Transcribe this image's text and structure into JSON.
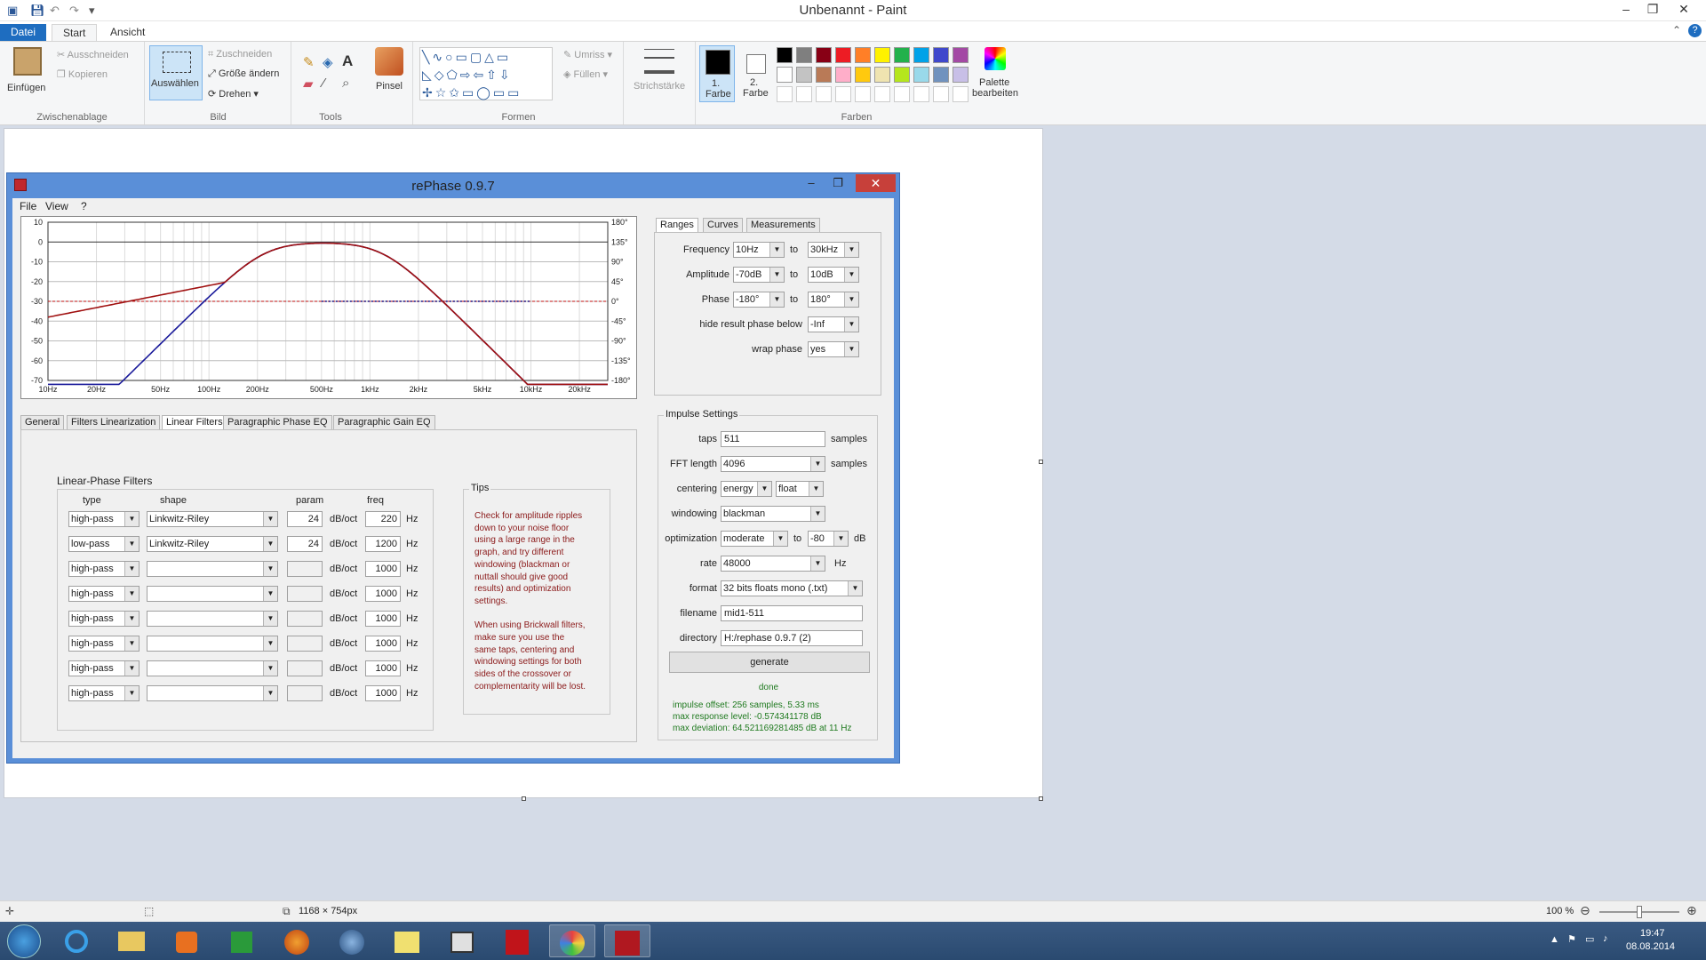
{
  "paint": {
    "title": "Unbenannt - Paint",
    "tabs": {
      "file": "Datei",
      "start": "Start",
      "view": "Ansicht"
    },
    "clipboard": {
      "paste": "Einfügen",
      "cut": "Ausschneiden",
      "copy": "Kopieren",
      "group": "Zwischenablage"
    },
    "image": {
      "select": "Auswählen",
      "crop": "Zuschneiden",
      "resize": "Größe ändern",
      "rotate": "Drehen",
      "group": "Bild"
    },
    "tools": {
      "group": "Tools",
      "brushes": "Pinsel"
    },
    "shapes": {
      "outline": "Umriss",
      "fill": "Füllen",
      "group": "Formen"
    },
    "size": {
      "label": "Strichstärke"
    },
    "colors": {
      "color1": "1.",
      "color1b": "Farbe",
      "color2": "2.",
      "color2b": "Farbe",
      "edit": "Palette",
      "editb": "bearbeiten",
      "group": "Farben",
      "palette": [
        "#000000",
        "#7f7f7f",
        "#880015",
        "#ed1c24",
        "#ff7f27",
        "#fff200",
        "#22b14c",
        "#00a2e8",
        "#3f48cc",
        "#a349a4",
        "#ffffff",
        "#c3c3c3",
        "#b97a57",
        "#ffaec9",
        "#ffc90e",
        "#efe4b0",
        "#b5e61d",
        "#99d9ea",
        "#7092be",
        "#c8bfe7"
      ]
    },
    "status": {
      "dimensions": "1168 × 754px",
      "zoom": "100 %"
    }
  },
  "rephase": {
    "title": "rePhase 0.9.7",
    "menu": [
      "File",
      "View",
      "?"
    ],
    "graph": {
      "left_ticks": [
        "10",
        "0",
        "-10",
        "-20",
        "-30",
        "-40",
        "-50",
        "-60",
        "-70"
      ],
      "right_ticks": [
        "180°",
        "135°",
        "90°",
        "45°",
        "0°",
        "-45°",
        "-90°",
        "-135°",
        "-180°"
      ],
      "freq_ticks": [
        "10Hz",
        "20Hz",
        "50Hz",
        "100Hz",
        "200Hz",
        "500Hz",
        "1kHz",
        "2kHz",
        "5kHz",
        "10kHz",
        "20kHz"
      ]
    },
    "filter_tabs": [
      "General",
      "Filters Linearization",
      "Linear Filters",
      "Paragraphic Phase EQ",
      "Paragraphic Gain EQ"
    ],
    "linear_filters": {
      "title": "Linear-Phase Filters",
      "headers": {
        "type": "type",
        "shape": "shape",
        "param": "param",
        "freq": "freq"
      },
      "unit_param": "dB/oct",
      "unit_freq": "Hz",
      "rows": [
        {
          "type": "high-pass",
          "shape": "Linkwitz-Riley",
          "param": "24",
          "freq": "220"
        },
        {
          "type": "low-pass",
          "shape": "Linkwitz-Riley",
          "param": "24",
          "freq": "1200"
        },
        {
          "type": "high-pass",
          "shape": "",
          "param": "",
          "freq": "1000"
        },
        {
          "type": "high-pass",
          "shape": "",
          "param": "",
          "freq": "1000"
        },
        {
          "type": "high-pass",
          "shape": "",
          "param": "",
          "freq": "1000"
        },
        {
          "type": "high-pass",
          "shape": "",
          "param": "",
          "freq": "1000"
        },
        {
          "type": "high-pass",
          "shape": "",
          "param": "",
          "freq": "1000"
        },
        {
          "type": "high-pass",
          "shape": "",
          "param": "",
          "freq": "1000"
        }
      ],
      "tips_title": "Tips",
      "tips_text": "Check for amplitude ripples\ndown to your noise floor\nusing a large range in the\ngraph, and try different\nwindowing (blackman or\nnuttall should give good\nresults) and optimization\nsettings.\n\nWhen using Brickwall filters,\nmake sure you use the\nsame taps, centering and\nwindowing settings for both\nsides of the crossover or\ncomplementarity will be lost."
    },
    "range_tabs": [
      "Ranges",
      "Curves",
      "Measurements"
    ],
    "ranges": {
      "frequency": {
        "label": "Frequency",
        "from": "10Hz",
        "to": "30kHz"
      },
      "amplitude": {
        "label": "Amplitude",
        "from": "-70dB",
        "to": "10dB"
      },
      "phase": {
        "label": "Phase",
        "from": "-180°",
        "to": "180°"
      },
      "to": "to",
      "hide": {
        "label": "hide result phase below",
        "value": "-Inf"
      },
      "wrap": {
        "label": "wrap phase",
        "value": "yes"
      }
    },
    "impulse": {
      "title": "Impulse Settings",
      "taps": {
        "label": "taps",
        "value": "511",
        "unit": "samples"
      },
      "fft": {
        "label": "FFT length",
        "value": "4096",
        "unit": "samples"
      },
      "centering": {
        "label": "centering",
        "value": "energy",
        "value2": "float"
      },
      "windowing": {
        "label": "windowing",
        "value": "blackman"
      },
      "optimization": {
        "label": "optimization",
        "value": "moderate",
        "to": "to",
        "value2": "-80",
        "unit": "dB"
      },
      "rate": {
        "label": "rate",
        "value": "48000",
        "unit": "Hz"
      },
      "format": {
        "label": "format",
        "value": "32 bits floats mono (.txt)"
      },
      "filename": {
        "label": "filename",
        "value": "mid1-511"
      },
      "directory": {
        "label": "directory",
        "value": "H:/rephase 0.9.7 (2)"
      },
      "generate": "generate",
      "done": "done",
      "result1": "impulse offset: 256 samples, 5.33 ms",
      "result2": "max response level: -0.574341178 dB",
      "result3": "max deviation: 64.521169281485 dB at 11 Hz"
    }
  },
  "taskbar": {
    "time": "19:47",
    "date": "08.08.2014"
  }
}
